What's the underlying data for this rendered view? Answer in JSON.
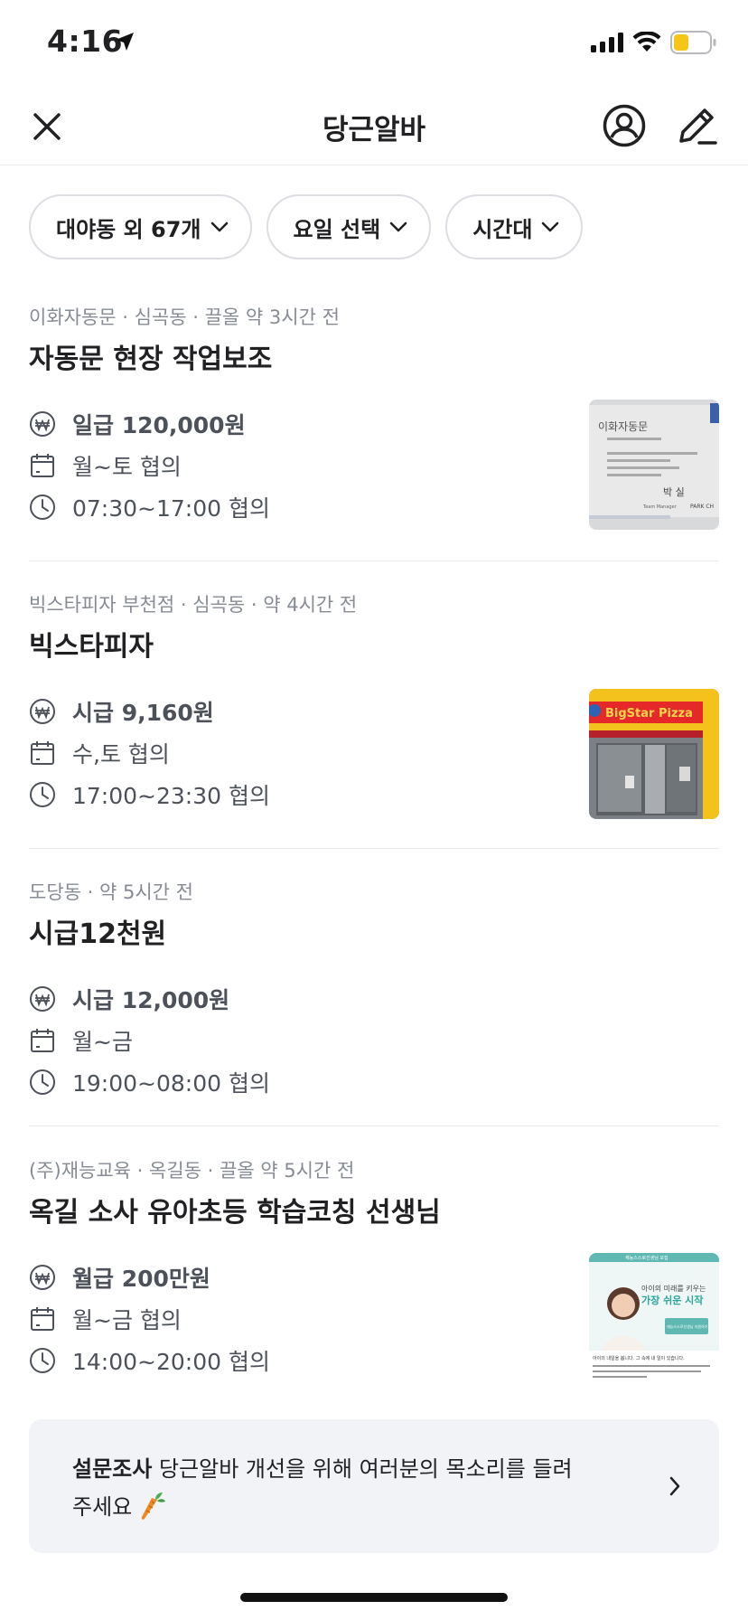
{
  "status_bar": {
    "time": "4:16"
  },
  "nav": {
    "title": "당근알바"
  },
  "filters": [
    {
      "label": "대야동 외 67개"
    },
    {
      "label": "요일 선택"
    },
    {
      "label": "시간대"
    }
  ],
  "jobs": [
    {
      "meta": "이화자동문 · 심곡동 · 끌올 약 3시간 전",
      "title": "자동문 현장 작업보조",
      "pay": "일급 120,000원",
      "days": "월~토 협의",
      "hours": "07:30~17:00 협의",
      "thumbnail": {
        "card_text": "이화자동문",
        "name_text": "박 실",
        "role_text": "Team Manager",
        "name_en": "PARK CH"
      }
    },
    {
      "meta": "빅스타피자 부천점 · 심곡동 · 약 4시간 전",
      "title": "빅스타피자",
      "pay": "시급 9,160원",
      "days": "수,토 협의",
      "hours": "17:00~23:30 협의",
      "thumbnail": {
        "sign_text": "BigStar Pizza"
      }
    },
    {
      "meta": "도당동 · 약 5시간 전",
      "title": "시급12천원",
      "pay": "시급 12,000원",
      "days": "월~금",
      "hours": "19:00~08:00 협의"
    },
    {
      "meta": "(주)재능교육 · 옥길동 · 끌올 약 5시간 전",
      "title": "옥길 소사 유아초등 학습코칭 선생님",
      "pay": "월급 200만원",
      "days": "월~금 협의",
      "hours": "14:00~20:00 협의",
      "thumbnail": {
        "header_text": "재능스스로선생님 모집",
        "headline1": "아이의 미래를 키우는",
        "headline2": "가장 쉬운 시작",
        "button_text": "재능스스로선생님 지원하기",
        "footer_text": "아이의 내일을 봅니다. 그 속에 내 일이 있습니다."
      }
    }
  ],
  "survey": {
    "label": "설문조사",
    "text": " 당근알바 개선을 위해 여러분의 목소리를 들려주세요 "
  },
  "icons": {
    "won": "won-icon",
    "calendar": "calendar-icon",
    "clock": "clock-icon"
  }
}
